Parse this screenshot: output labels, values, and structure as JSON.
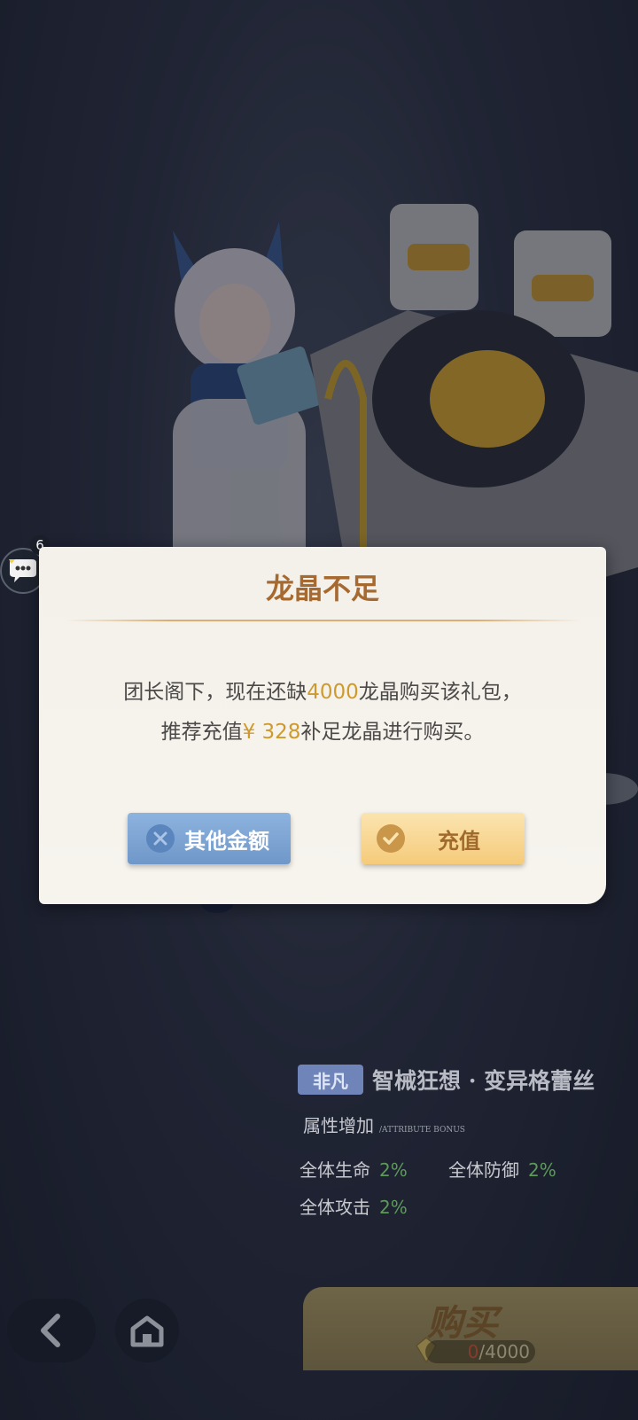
{
  "chat": {
    "badge_count": "6"
  },
  "dialog": {
    "title": "龙晶不足",
    "line1_prefix": "团长阁下，现在还缺",
    "line1_amount": "4000",
    "line1_suffix": "龙晶购买该礼包，",
    "line2_prefix": "推荐充值",
    "line2_amount": "¥ 328",
    "line2_suffix": "补足龙晶进行购买。",
    "other_amount_label": "其他金额",
    "recharge_label": "充值"
  },
  "set_info": {
    "badge_text": "非凡",
    "name": "智械狂想 · 变异格蕾丝",
    "attr_title": "属性增加",
    "attr_subtitle": "/ATTRIBUTE BONUS",
    "attributes": [
      {
        "label": "全体生命",
        "value": "2%"
      },
      {
        "label": "全体防御",
        "value": "2%"
      },
      {
        "label": "全体攻击",
        "value": "2%"
      }
    ]
  },
  "purchase": {
    "buy_label": "购买",
    "owned": "0",
    "separator": "/",
    "cost": "4000"
  },
  "colors": {
    "title": "#a66a31",
    "highlight": "#cf9a2d",
    "attr_value": "#5d9a5a",
    "other_button": "#7aa3d4",
    "recharge_button": "#f7d48c"
  }
}
